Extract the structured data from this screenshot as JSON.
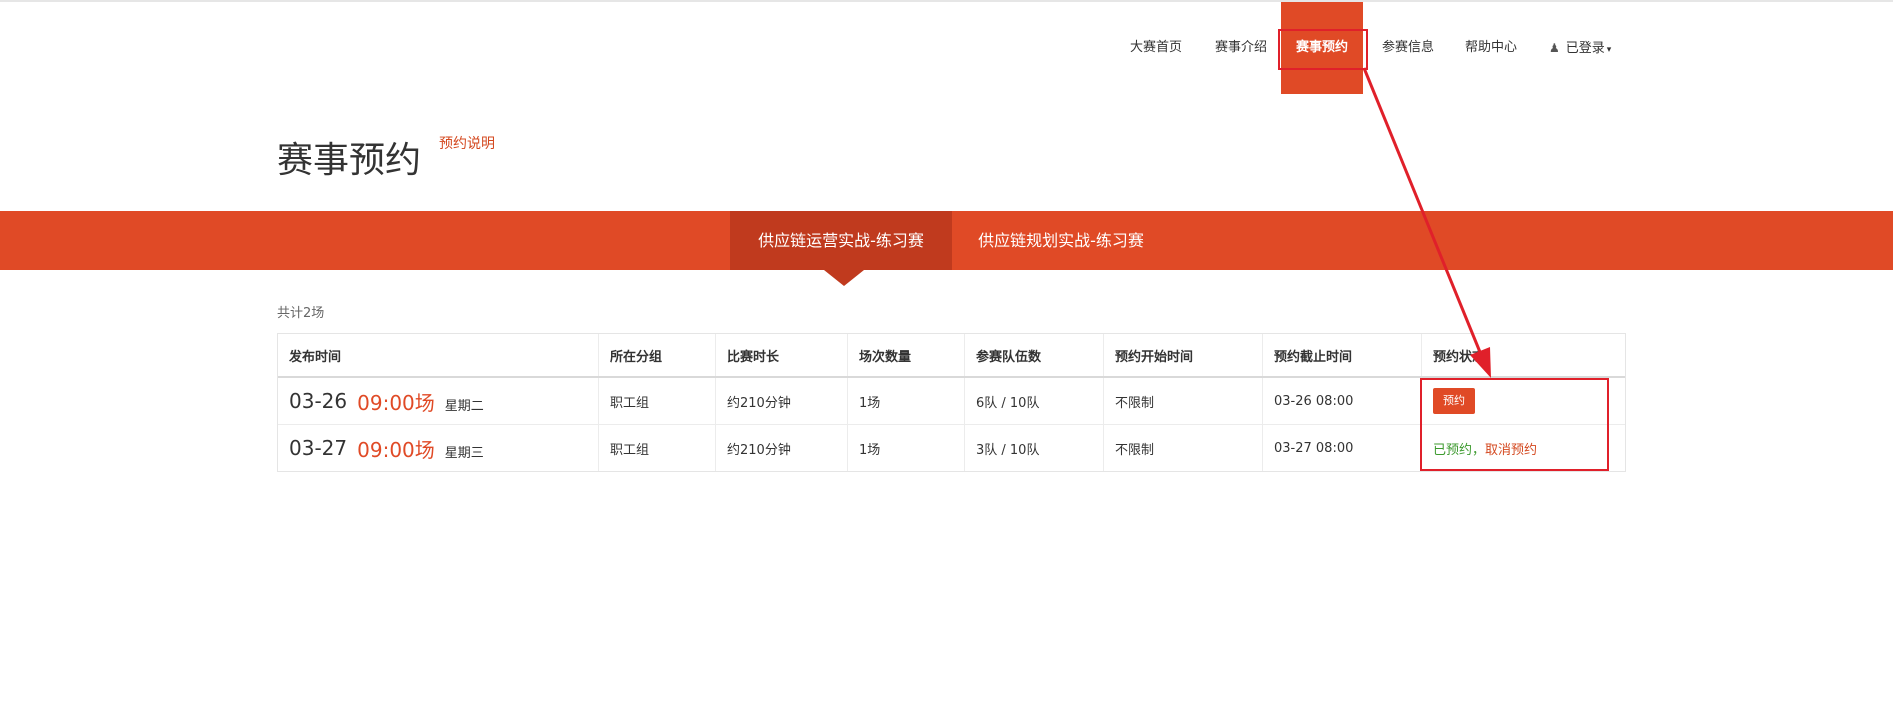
{
  "nav": {
    "items": [
      {
        "label": "大赛首页"
      },
      {
        "label": "赛事介绍"
      },
      {
        "label": "赛事预约"
      },
      {
        "label": "参赛信息"
      },
      {
        "label": "帮助中心"
      }
    ],
    "user_label": "已登录",
    "active_index": 2
  },
  "page": {
    "title": "赛事预约",
    "help_link": "预约说明"
  },
  "tabs": [
    {
      "label": "供应链运营实战-练习赛",
      "active": true
    },
    {
      "label": "供应链规划实战-练习赛",
      "active": false
    }
  ],
  "summary": "共计2场",
  "table": {
    "headers": [
      "发布时间",
      "所在分组",
      "比赛时长",
      "场次数量",
      "参赛队伍数",
      "预约开始时间",
      "预约截止时间",
      "预约状态"
    ],
    "rows": [
      {
        "date": "03-26",
        "time": "09:00场",
        "weekday": "星期二",
        "group": "职工组",
        "duration": "约210分钟",
        "sessions": "1场",
        "teams": "6队 / 10队",
        "start": "不限制",
        "deadline": "03-26 08:00",
        "action_label": "预约"
      },
      {
        "date": "03-27",
        "time": "09:00场",
        "weekday": "星期三",
        "group": "职工组",
        "duration": "约210分钟",
        "sessions": "1场",
        "teams": "3队 / 10队",
        "start": "不限制",
        "deadline": "03-27 08:00",
        "status_booked": "已预约",
        "status_sep": "，",
        "cancel_label": "取消预约"
      }
    ]
  },
  "colors": {
    "accent": "#e04a26",
    "accent_dark": "#c03a1e",
    "success": "#3c9a2e",
    "annotation": "#e0202a"
  }
}
